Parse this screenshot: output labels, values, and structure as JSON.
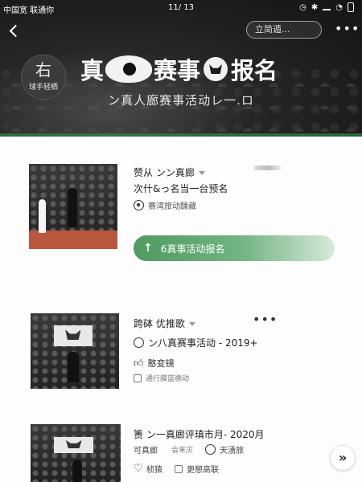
{
  "status_bar": {
    "carrier": "中国宽 联通你",
    "page_counter": "11/ 13"
  },
  "header": {
    "search_placeholder": "立简遁...",
    "logo_mark": "右",
    "logo_sub": "球手轻栖",
    "title_left": "真",
    "title_mid": "赛事",
    "title_right": "报名",
    "subtitle": "ン真人廊赛事活动レ一.ロ"
  },
  "items": [
    {
      "title": "赞从 ンン真廊",
      "subline": "次什&っ名当一台预名",
      "meta": "赛湾旅动醺藏"
    },
    {
      "title": "跨砵  优推歌",
      "subline": "ン八真赛事活动 - 2019+",
      "like_label": "憨变镜",
      "meta": "通行膜蓝德动"
    },
    {
      "title": "箦 ン一真廊评瑱市月- 2020月",
      "meta_left": "可真廊",
      "meta_mid": "会来灾",
      "meta_right": "天湧旅",
      "fav_label": "桢猿",
      "check_label": "更憩高联"
    }
  ],
  "register_button": {
    "label": "6真事活动报名"
  },
  "fab": {
    "icon": "double-chevron-right-icon"
  },
  "colors": {
    "accent_green": "#4f9a61",
    "hero_dark": "#1a1a1a"
  }
}
